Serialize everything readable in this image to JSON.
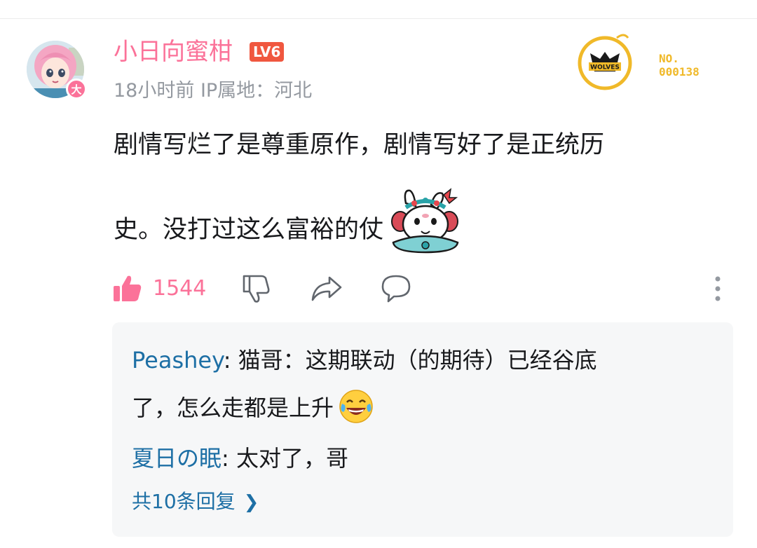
{
  "comment": {
    "username": "小日向蜜柑",
    "level_badge": "LV6",
    "vip_badge": "大",
    "meta": "18小时前 IP属地：河北",
    "fan_badge": {
      "number_label": "NO.",
      "number_value": "000138",
      "team": "WOLVES",
      "color": "#f0b929"
    },
    "content_line1": "剧情写烂了是尊重原作，剧情写好了是正统历",
    "content_line2": "史。没打过这么富裕的仗",
    "sticker": "bunny-opera-sticker",
    "actions": {
      "like_count": "1544",
      "like_color": "#fb7299"
    }
  },
  "replies": [
    {
      "name": "Peashey",
      "text_line1": ": 猫哥：这期联动（的期待）已经谷底",
      "text_line2": "了，怎么走都是上升",
      "emoji": "laughing-tears-emoji"
    },
    {
      "name": "夏日の眠",
      "text": ": 太对了，哥"
    }
  ],
  "more_replies": "共10条回复"
}
